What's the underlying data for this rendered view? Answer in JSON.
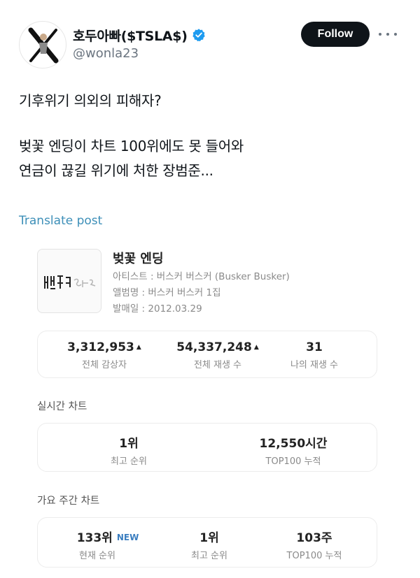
{
  "colors": {
    "follow_bg": "#0f1419",
    "translate_link": "#3d8fb8",
    "verified_badge": "#1d9bf0",
    "new_badge": "#3b7ec0"
  },
  "author": {
    "display_name": "호두아빠($TSLA$)",
    "handle": "@wonla23",
    "verified": true,
    "avatar_icon": "x-logo-person-avatar"
  },
  "follow_label": "Follow",
  "tweet": {
    "line1": "기후위기 의외의 피해자?",
    "line2": "벚꽃 엔딩이 차트 100위에도 못 들어와",
    "line3": "연금이 끊길 위기에 처한 장범준..."
  },
  "translate_label": "Translate post",
  "song": {
    "title": "벚꽃 엔딩",
    "artist": "아티스트 : 버스커 버스커 (Busker Busker)",
    "album": "앨범명 : 버스커 버스커 1집",
    "release": "발매일 : 2012.03.29"
  },
  "totals": {
    "listeners_value": "3,312,953",
    "listeners_label": "전체 감상자",
    "plays_value": "54,337,248",
    "plays_label": "전체 재생 수",
    "my_plays_value": "31",
    "my_plays_label": "나의 재생 수"
  },
  "realtime": {
    "title": "실시간 차트",
    "best_rank_value": "1위",
    "best_rank_label": "최고 순위",
    "top100_value": "12,550시간",
    "top100_label": "TOP100 누적"
  },
  "weekly": {
    "title": "가요 주간 차트",
    "current_rank_value": "133위",
    "current_rank_badge": "NEW",
    "current_rank_label": "현재 순위",
    "best_rank_value": "1위",
    "best_rank_label": "최고 순위",
    "top100_value": "103주",
    "top100_label": "TOP100 누적"
  }
}
